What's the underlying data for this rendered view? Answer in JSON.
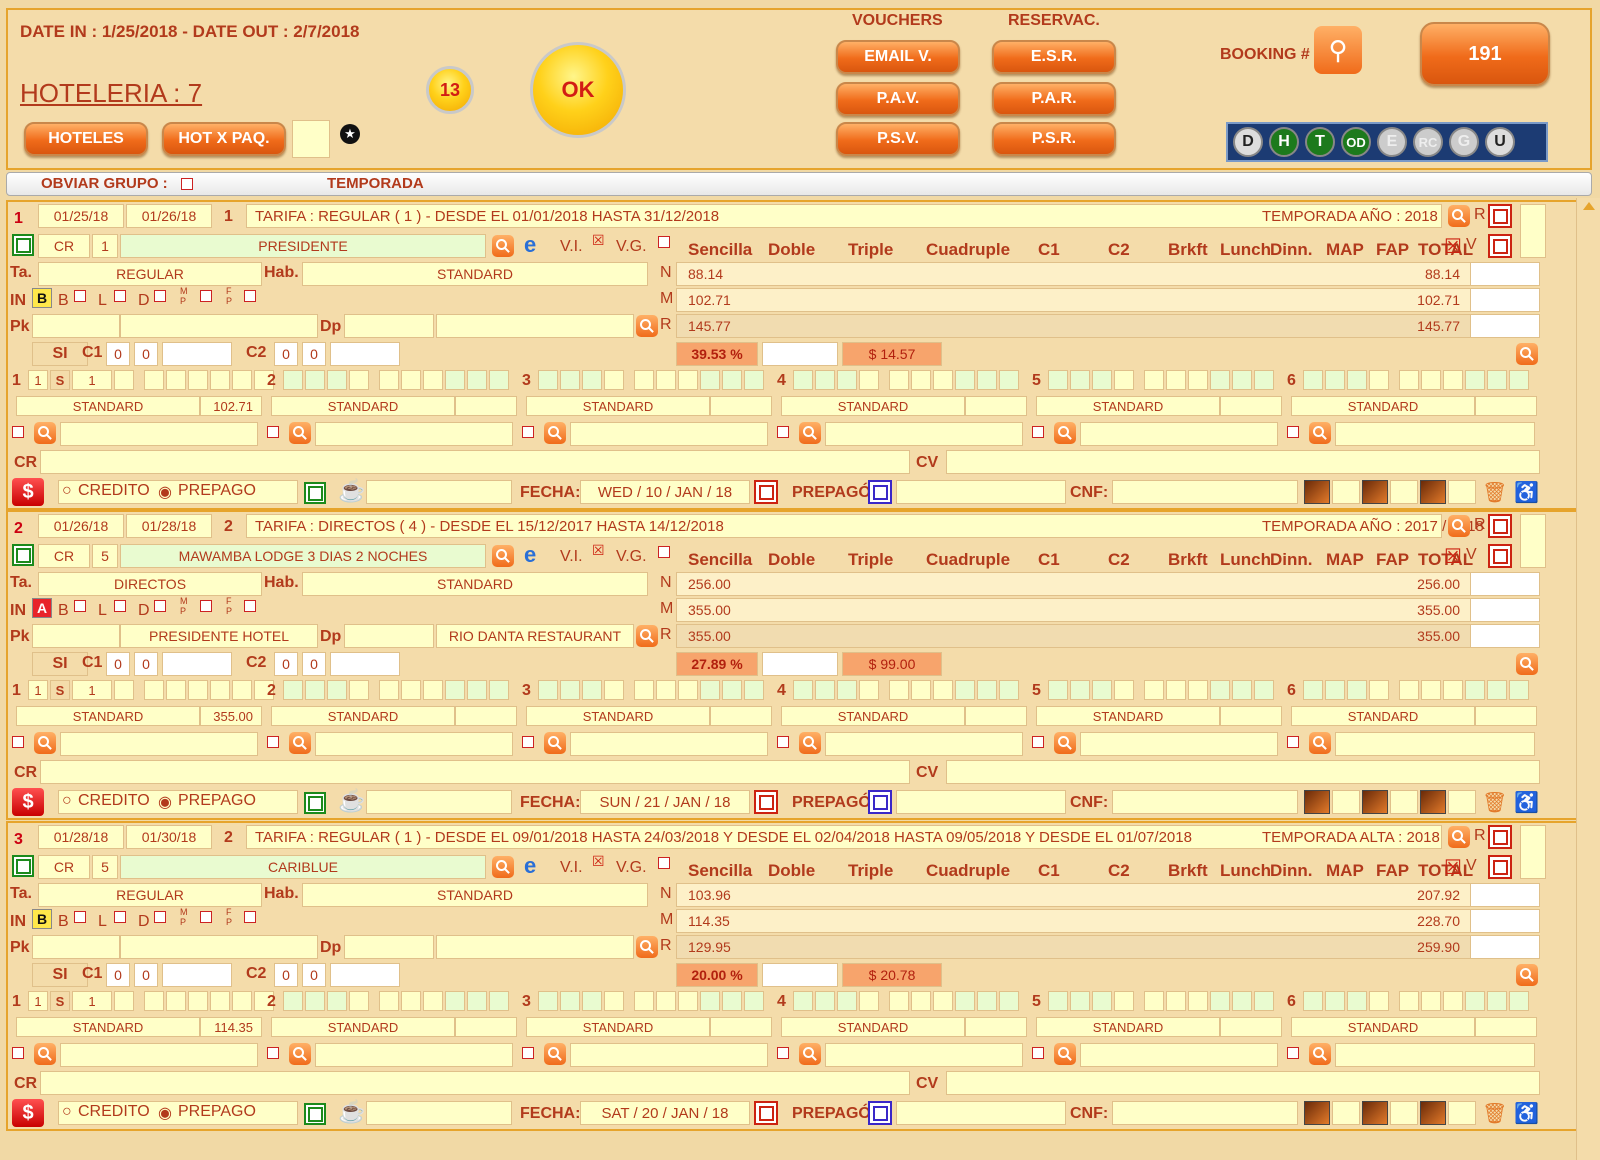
{
  "header": {
    "dates": "DATE IN : 1/25/2018 - DATE OUT : 2/7/2018",
    "hoteleria": "HOTELERIA : 7",
    "hoteles_btn": "HOTELES",
    "hotpaq_btn": "HOT X PAQ.",
    "circle_count": "13",
    "ok": "OK",
    "vouchers_title": "VOUCHERS",
    "reservac_title": "RESERVAC.",
    "vouchers": [
      "EMAIL V.",
      "P.A.V.",
      "P.S.V."
    ],
    "reservac": [
      "E.S.R.",
      "P.A.R.",
      "P.S.R."
    ],
    "booking_label": "BOOKING #",
    "booking_number": "191",
    "codes": [
      "D",
      "H",
      "T",
      "OD",
      "E",
      "RC",
      "G",
      "U"
    ]
  },
  "bar": {
    "obviar": "OBVIAR GRUPO :",
    "temporada": "TEMPORADA"
  },
  "labels": {
    "cr": "CR",
    "ta": "Ta.",
    "hab": "Hab.",
    "in": "IN",
    "pk": "Pk",
    "dp": "Dp",
    "si": "SI",
    "c1": "C1",
    "c2": "C2",
    "vi": "V.I.",
    "vg": "V.G.",
    "b": "B",
    "l": "L",
    "d": "D",
    "mp": "M P",
    "fp": "F P",
    "cv": "CV",
    "credito": "CREDITO",
    "prepago": "PREPAGO",
    "fecha": "FECHA:",
    "prepago_paid": "PREPAGÓ",
    "cnf": "CNF:",
    "r": "R",
    "v": "V",
    "n": "N",
    "m": "M",
    "rr": "R",
    "cols": [
      "Sencilla",
      "Doble",
      "Triple",
      "Cuadruple",
      "C1",
      "C2",
      "Brkft",
      "Lunch",
      "Dinn.",
      "MAP",
      "FAP",
      "TOTAL"
    ],
    "zero": "0",
    "room_nums": [
      "1",
      "2",
      "3",
      "4",
      "5",
      "6"
    ],
    "s": "S",
    "one": "1"
  },
  "sections": [
    {
      "num": "1",
      "date_in": "01/25/18",
      "date_out": "01/26/18",
      "nights": "1",
      "tarifa": "TARIFA : REGULAR ( 1 ) - DESDE EL 01/01/2018 HASTA 31/12/2018",
      "temporada": "TEMPORADA AÑO : 2018",
      "cr_num": "1",
      "hotel": "PRESIDENTE",
      "ta_val": "REGULAR",
      "hab_val": "STANDARD",
      "in_badge": "B",
      "pk_val": "",
      "dp_val": "",
      "n_val": "88.14",
      "m_val": "102.71",
      "r_val": "145.77",
      "n_tot": "88.14",
      "m_tot": "102.71",
      "r_tot": "145.77",
      "pct": "39.53 %",
      "amount": "$ 14.57",
      "room_price": "102.71",
      "fecha": "WED / 10 / JAN / 18"
    },
    {
      "num": "2",
      "date_in": "01/26/18",
      "date_out": "01/28/18",
      "nights": "2",
      "tarifa": "TARIFA : DIRECTOS ( 4 ) - DESDE EL 15/12/2017 HASTA 14/12/2018",
      "temporada": "TEMPORADA AÑO : 2017 / 2018",
      "cr_num": "5",
      "hotel": "MAWAMBA LODGE 3 DIAS 2 NOCHES",
      "ta_val": "DIRECTOS",
      "hab_val": "STANDARD",
      "in_badge": "A",
      "pk_val": "PRESIDENTE HOTEL",
      "dp_val": "RIO DANTA RESTAURANT",
      "n_val": "256.00",
      "m_val": "355.00",
      "r_val": "355.00",
      "n_tot": "256.00",
      "m_tot": "355.00",
      "r_tot": "355.00",
      "pct": "27.89 %",
      "amount": "$ 99.00",
      "room_price": "355.00",
      "fecha": "SUN / 21 / JAN / 18"
    },
    {
      "num": "3",
      "date_in": "01/28/18",
      "date_out": "01/30/18",
      "nights": "2",
      "tarifa": "TARIFA : REGULAR ( 1 ) - DESDE EL 09/01/2018 HASTA 24/03/2018 Y DESDE EL 02/04/2018 HASTA 09/05/2018 Y DESDE EL 01/07/2018",
      "temporada": "TEMPORADA ALTA : 2018",
      "cr_num": "5",
      "hotel": "CARIBLUE",
      "ta_val": "REGULAR",
      "hab_val": "STANDARD",
      "in_badge": "B",
      "pk_val": "",
      "dp_val": "",
      "n_val": "103.96",
      "m_val": "114.35",
      "r_val": "129.95",
      "n_tot": "207.92",
      "m_tot": "228.70",
      "r_tot": "259.90",
      "pct": "20.00 %",
      "amount": "$ 20.78",
      "room_price": "114.35",
      "fecha": "SAT / 20 / JAN / 18"
    }
  ],
  "room_types": [
    "STANDARD",
    "STANDARD",
    "STANDARD",
    "STANDARD",
    "STANDARD",
    "STANDARD"
  ],
  "colors": {
    "accent": "#f06b1a",
    "bg": "#f1d9a5",
    "field": "#ffffc8",
    "text": "#b23a1c"
  }
}
